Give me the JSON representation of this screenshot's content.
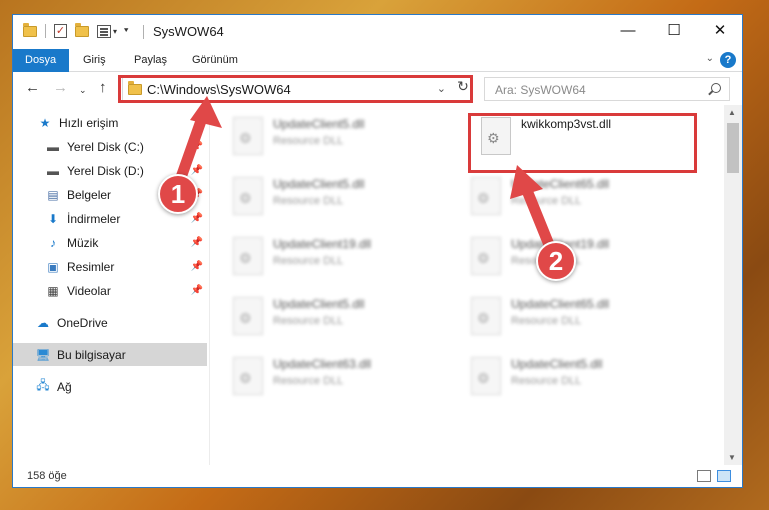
{
  "window": {
    "title": "SysWOW64",
    "controls": {
      "minimize": "—",
      "maximize": "☐",
      "close": "✕"
    }
  },
  "ribbon": {
    "tabs": [
      {
        "label": "Dosya",
        "active": true
      },
      {
        "label": "Giriş"
      },
      {
        "label": "Paylaş"
      },
      {
        "label": "Görünüm"
      }
    ],
    "help": "?"
  },
  "navigation": {
    "address": "C:\\Windows\\SysWOW64",
    "search_placeholder": "Ara: SysWOW64"
  },
  "sidebar": {
    "items": [
      {
        "label": "Hızlı erişim",
        "icon": "star-icon"
      },
      {
        "label": "Yerel Disk (C:)",
        "icon": "drive-icon",
        "pinned": true
      },
      {
        "label": "Yerel Disk (D:)",
        "icon": "drive-icon",
        "pinned": true
      },
      {
        "label": "Belgeler",
        "icon": "documents-icon",
        "pinned": true
      },
      {
        "label": "İndirmeler",
        "icon": "download-icon",
        "pinned": true
      },
      {
        "label": "Müzik",
        "icon": "music-icon",
        "pinned": true
      },
      {
        "label": "Resimler",
        "icon": "pictures-icon",
        "pinned": true
      },
      {
        "label": "Videolar",
        "icon": "videos-icon",
        "pinned": true
      },
      {
        "label": "OneDrive",
        "icon": "cloud-icon"
      },
      {
        "label": "Bu bilgisayar",
        "icon": "computer-icon",
        "selected": true
      },
      {
        "label": "Ağ",
        "icon": "network-icon"
      }
    ]
  },
  "files": [
    {
      "name": "UpdateClient5.dll",
      "type": "Resource DLL",
      "blurred": true
    },
    {
      "name": "kwikkomp3vst.dll",
      "type": "",
      "highlighted": true
    },
    {
      "name": "UpdateClient5.dll",
      "type": "Resource DLL",
      "blurred": true
    },
    {
      "name": "UpdateClient65.dll",
      "type": "Resource DLL",
      "blurred": true
    },
    {
      "name": "UpdateClient19.dll",
      "type": "Resource DLL",
      "blurred": true
    },
    {
      "name": "UpdateClient19.dll",
      "type": "Resource DLL",
      "blurred": true
    },
    {
      "name": "UpdateClient5.dll",
      "type": "Resource DLL",
      "blurred": true
    },
    {
      "name": "UpdateClient65.dll",
      "type": "Resource DLL",
      "blurred": true
    },
    {
      "name": "UpdateClient63.dll",
      "type": "Resource DLL",
      "blurred": true
    },
    {
      "name": "UpdateClient5.dll",
      "type": "Resource DLL",
      "blurred": true
    }
  ],
  "status": {
    "item_count": "158 öğe"
  },
  "callouts": [
    {
      "number": "1",
      "color": "#e04848"
    },
    {
      "number": "2",
      "color": "#e04848"
    }
  ],
  "colors": {
    "accent": "#1979ca",
    "highlight": "#d93a3a"
  }
}
